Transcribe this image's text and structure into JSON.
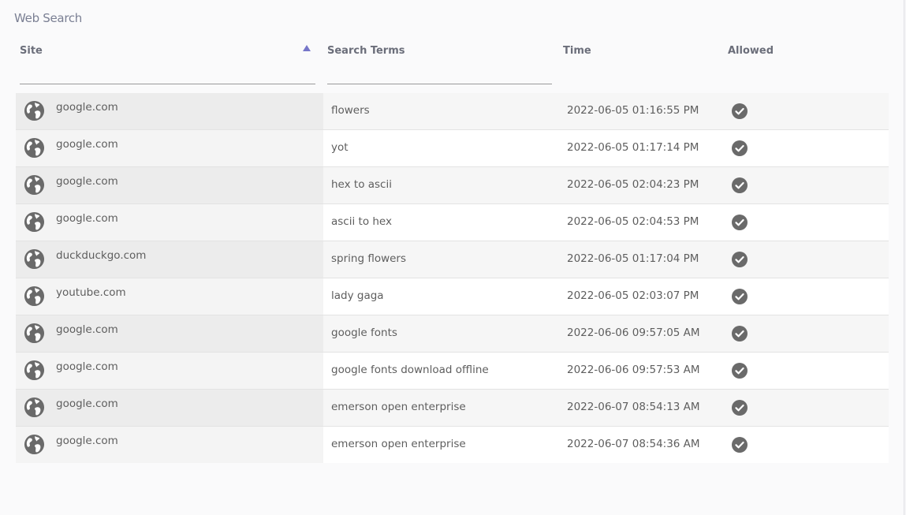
{
  "title": "Web Search",
  "columns": {
    "site": "Site",
    "terms": "Search Terms",
    "time": "Time",
    "allowed": "Allowed"
  },
  "filters": {
    "site": "",
    "terms": ""
  },
  "sort": {
    "column": "site",
    "direction": "ascending"
  },
  "rows": [
    {
      "site": "google.com",
      "terms": "flowers",
      "time": "2022-06-05 01:16:55 PM",
      "allowed": true
    },
    {
      "site": "google.com",
      "terms": "yot",
      "time": "2022-06-05 01:17:14 PM",
      "allowed": true
    },
    {
      "site": "google.com",
      "terms": "hex to ascii",
      "time": "2022-06-05 02:04:23 PM",
      "allowed": true
    },
    {
      "site": "google.com",
      "terms": "ascii to hex",
      "time": "2022-06-05 02:04:53 PM",
      "allowed": true
    },
    {
      "site": "duckduckgo.com",
      "terms": "spring flowers",
      "time": "2022-06-05 01:17:04 PM",
      "allowed": true
    },
    {
      "site": "youtube.com",
      "terms": "lady gaga",
      "time": "2022-06-05 02:03:07 PM",
      "allowed": true
    },
    {
      "site": "google.com",
      "terms": "google fonts",
      "time": "2022-06-06 09:57:05 AM",
      "allowed": true
    },
    {
      "site": "google.com",
      "terms": "google fonts download offline",
      "time": "2022-06-06 09:57:53 AM",
      "allowed": true
    },
    {
      "site": "google.com",
      "terms": "emerson open enterprise",
      "time": "2022-06-07 08:54:13 AM",
      "allowed": true
    },
    {
      "site": "google.com",
      "terms": "emerson open enterprise",
      "time": "2022-06-07 08:54:36 AM",
      "allowed": true
    }
  ],
  "icons": {
    "site": "globe-icon",
    "allowed": "check-circle-icon",
    "sort": "sort-ascending-icon"
  },
  "colors": {
    "accent": "#7676c9",
    "icon": "#6a6a6a",
    "text": "#5e5e5e"
  }
}
